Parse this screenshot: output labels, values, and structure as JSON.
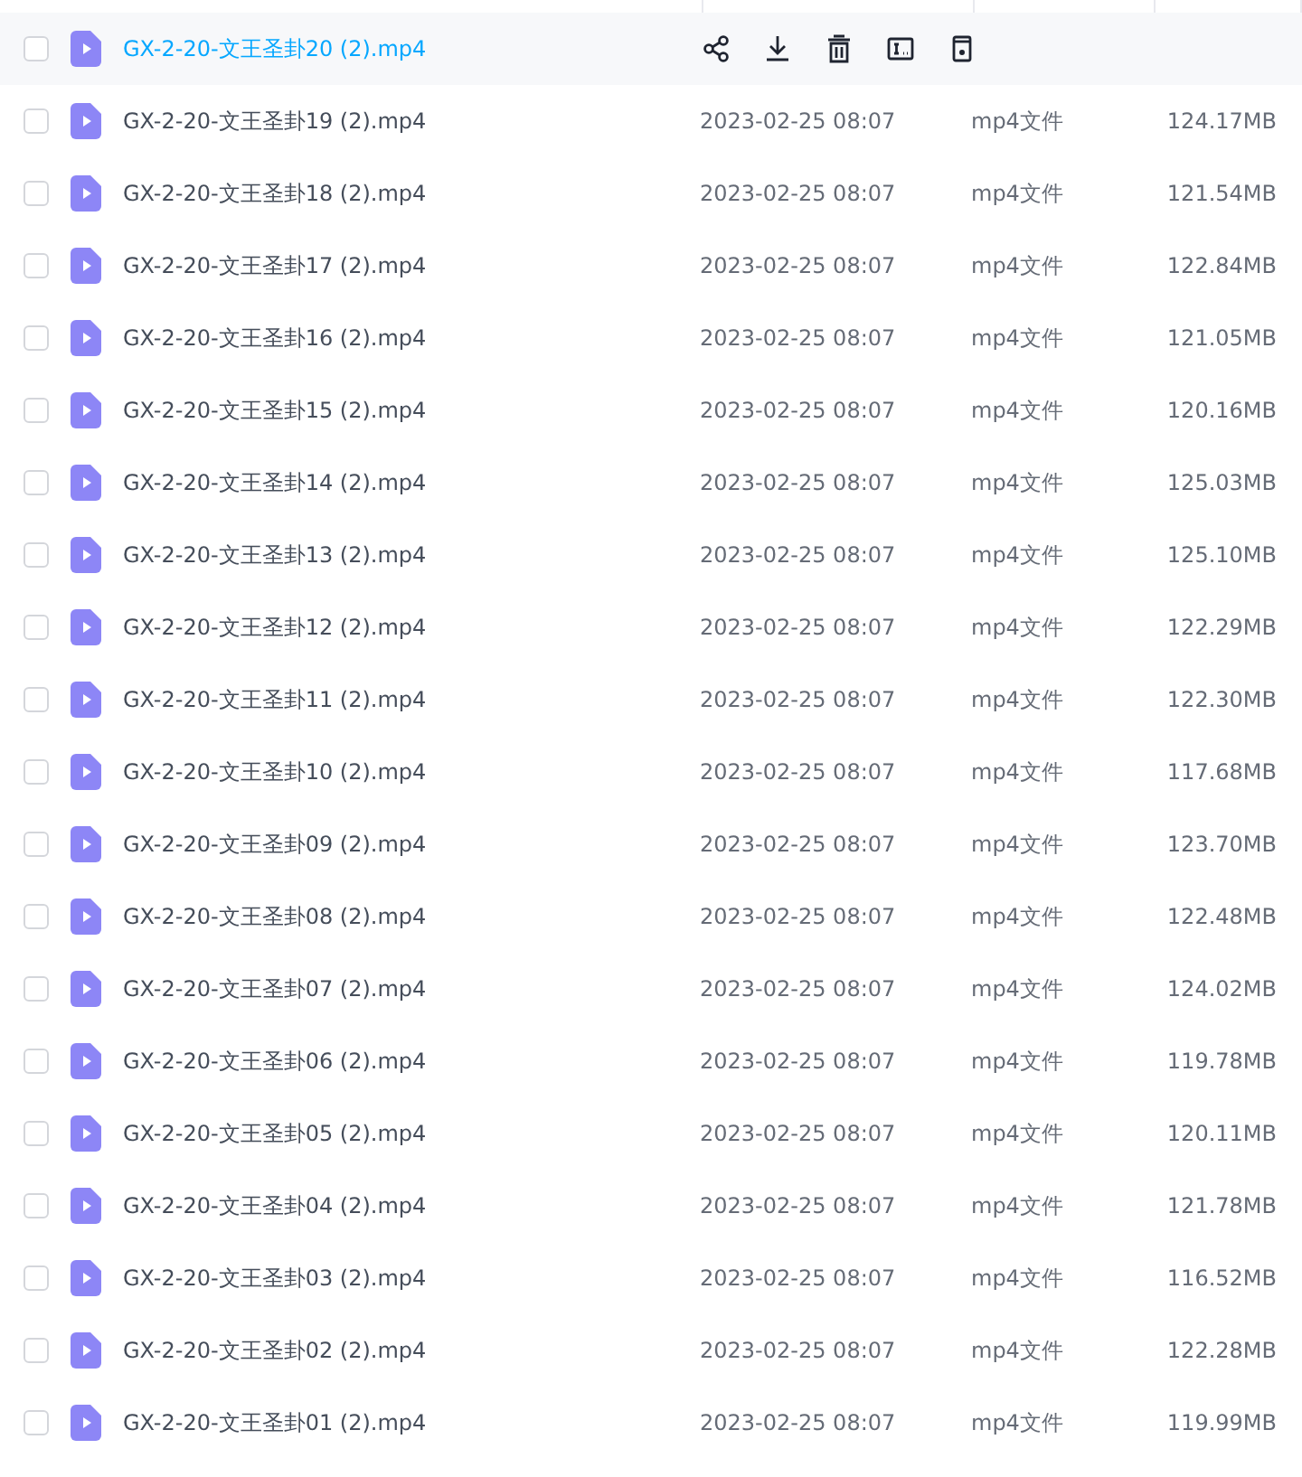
{
  "files": [
    {
      "name": "GX-2-20-文王圣卦20 (2).mp4",
      "checked": false,
      "hovered": true
    },
    {
      "name": "GX-2-20-文王圣卦19 (2).mp4",
      "checked": false,
      "hovered": false,
      "modified": "2023-02-25 08:07",
      "type": "mp4文件",
      "size": "124.17MB"
    },
    {
      "name": "GX-2-20-文王圣卦18 (2).mp4",
      "checked": false,
      "hovered": false,
      "modified": "2023-02-25 08:07",
      "type": "mp4文件",
      "size": "121.54MB"
    },
    {
      "name": "GX-2-20-文王圣卦17 (2).mp4",
      "checked": false,
      "hovered": false,
      "modified": "2023-02-25 08:07",
      "type": "mp4文件",
      "size": "122.84MB"
    },
    {
      "name": "GX-2-20-文王圣卦16 (2).mp4",
      "checked": false,
      "hovered": false,
      "modified": "2023-02-25 08:07",
      "type": "mp4文件",
      "size": "121.05MB"
    },
    {
      "name": "GX-2-20-文王圣卦15 (2).mp4",
      "checked": false,
      "hovered": false,
      "modified": "2023-02-25 08:07",
      "type": "mp4文件",
      "size": "120.16MB"
    },
    {
      "name": "GX-2-20-文王圣卦14 (2).mp4",
      "checked": false,
      "hovered": false,
      "modified": "2023-02-25 08:07",
      "type": "mp4文件",
      "size": "125.03MB"
    },
    {
      "name": "GX-2-20-文王圣卦13 (2).mp4",
      "checked": false,
      "hovered": false,
      "modified": "2023-02-25 08:07",
      "type": "mp4文件",
      "size": "125.10MB"
    },
    {
      "name": "GX-2-20-文王圣卦12 (2).mp4",
      "checked": false,
      "hovered": false,
      "modified": "2023-02-25 08:07",
      "type": "mp4文件",
      "size": "122.29MB"
    },
    {
      "name": "GX-2-20-文王圣卦11 (2).mp4",
      "checked": false,
      "hovered": false,
      "modified": "2023-02-25 08:07",
      "type": "mp4文件",
      "size": "122.30MB"
    },
    {
      "name": "GX-2-20-文王圣卦10 (2).mp4",
      "checked": false,
      "hovered": false,
      "modified": "2023-02-25 08:07",
      "type": "mp4文件",
      "size": "117.68MB"
    },
    {
      "name": "GX-2-20-文王圣卦09 (2).mp4",
      "checked": false,
      "hovered": false,
      "modified": "2023-02-25 08:07",
      "type": "mp4文件",
      "size": "123.70MB"
    },
    {
      "name": "GX-2-20-文王圣卦08 (2).mp4",
      "checked": false,
      "hovered": false,
      "modified": "2023-02-25 08:07",
      "type": "mp4文件",
      "size": "122.48MB"
    },
    {
      "name": "GX-2-20-文王圣卦07 (2).mp4",
      "checked": false,
      "hovered": false,
      "modified": "2023-02-25 08:07",
      "type": "mp4文件",
      "size": "124.02MB"
    },
    {
      "name": "GX-2-20-文王圣卦06 (2).mp4",
      "checked": false,
      "hovered": false,
      "modified": "2023-02-25 08:07",
      "type": "mp4文件",
      "size": "119.78MB"
    },
    {
      "name": "GX-2-20-文王圣卦05 (2).mp4",
      "checked": false,
      "hovered": false,
      "modified": "2023-02-25 08:07",
      "type": "mp4文件",
      "size": "120.11MB"
    },
    {
      "name": "GX-2-20-文王圣卦04 (2).mp4",
      "checked": false,
      "hovered": false,
      "modified": "2023-02-25 08:07",
      "type": "mp4文件",
      "size": "121.78MB"
    },
    {
      "name": "GX-2-20-文王圣卦03 (2).mp4",
      "checked": false,
      "hovered": false,
      "modified": "2023-02-25 08:07",
      "type": "mp4文件",
      "size": "116.52MB"
    },
    {
      "name": "GX-2-20-文王圣卦02 (2).mp4",
      "checked": false,
      "hovered": false,
      "modified": "2023-02-25 08:07",
      "type": "mp4文件",
      "size": "122.28MB"
    },
    {
      "name": "GX-2-20-文王圣卦01 (2).mp4",
      "checked": false,
      "hovered": false,
      "modified": "2023-02-25 08:07",
      "type": "mp4文件",
      "size": "119.99MB"
    }
  ]
}
